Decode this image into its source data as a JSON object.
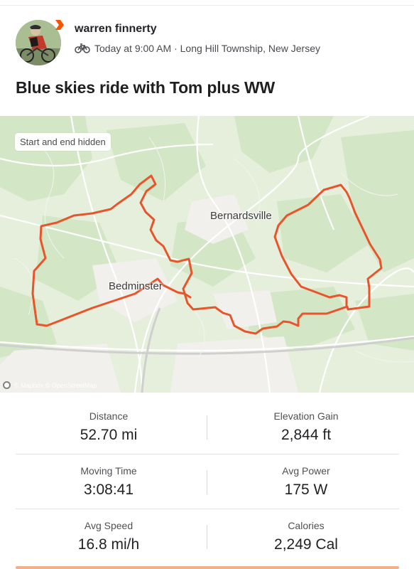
{
  "athlete": {
    "name": "warren finnerty",
    "activity_meta": "Today at 9:00 AM · Long Hill Township, New Jersey",
    "activity_icon": "bike-icon"
  },
  "activity": {
    "title": "Blue skies ride with Tom plus WW"
  },
  "map": {
    "privacy_label": "Start and end hidden",
    "places": [
      "Bernardsville",
      "Bedminster"
    ],
    "attribution": "© Mapbox © OpenStreetMap",
    "route_color": "#e8552b"
  },
  "stats": [
    {
      "left": {
        "label": "Distance",
        "value": "52.70 mi"
      },
      "right": {
        "label": "Elevation Gain",
        "value": "2,844 ft"
      }
    },
    {
      "left": {
        "label": "Moving Time",
        "value": "3:08:41"
      },
      "right": {
        "label": "Avg Power",
        "value": "175 W"
      }
    },
    {
      "left": {
        "label": "Avg Speed",
        "value": "16.8 mi/h"
      },
      "right": {
        "label": "Calories",
        "value": "2,249 Cal"
      }
    }
  ],
  "colors": {
    "brand": "#fc5200"
  }
}
